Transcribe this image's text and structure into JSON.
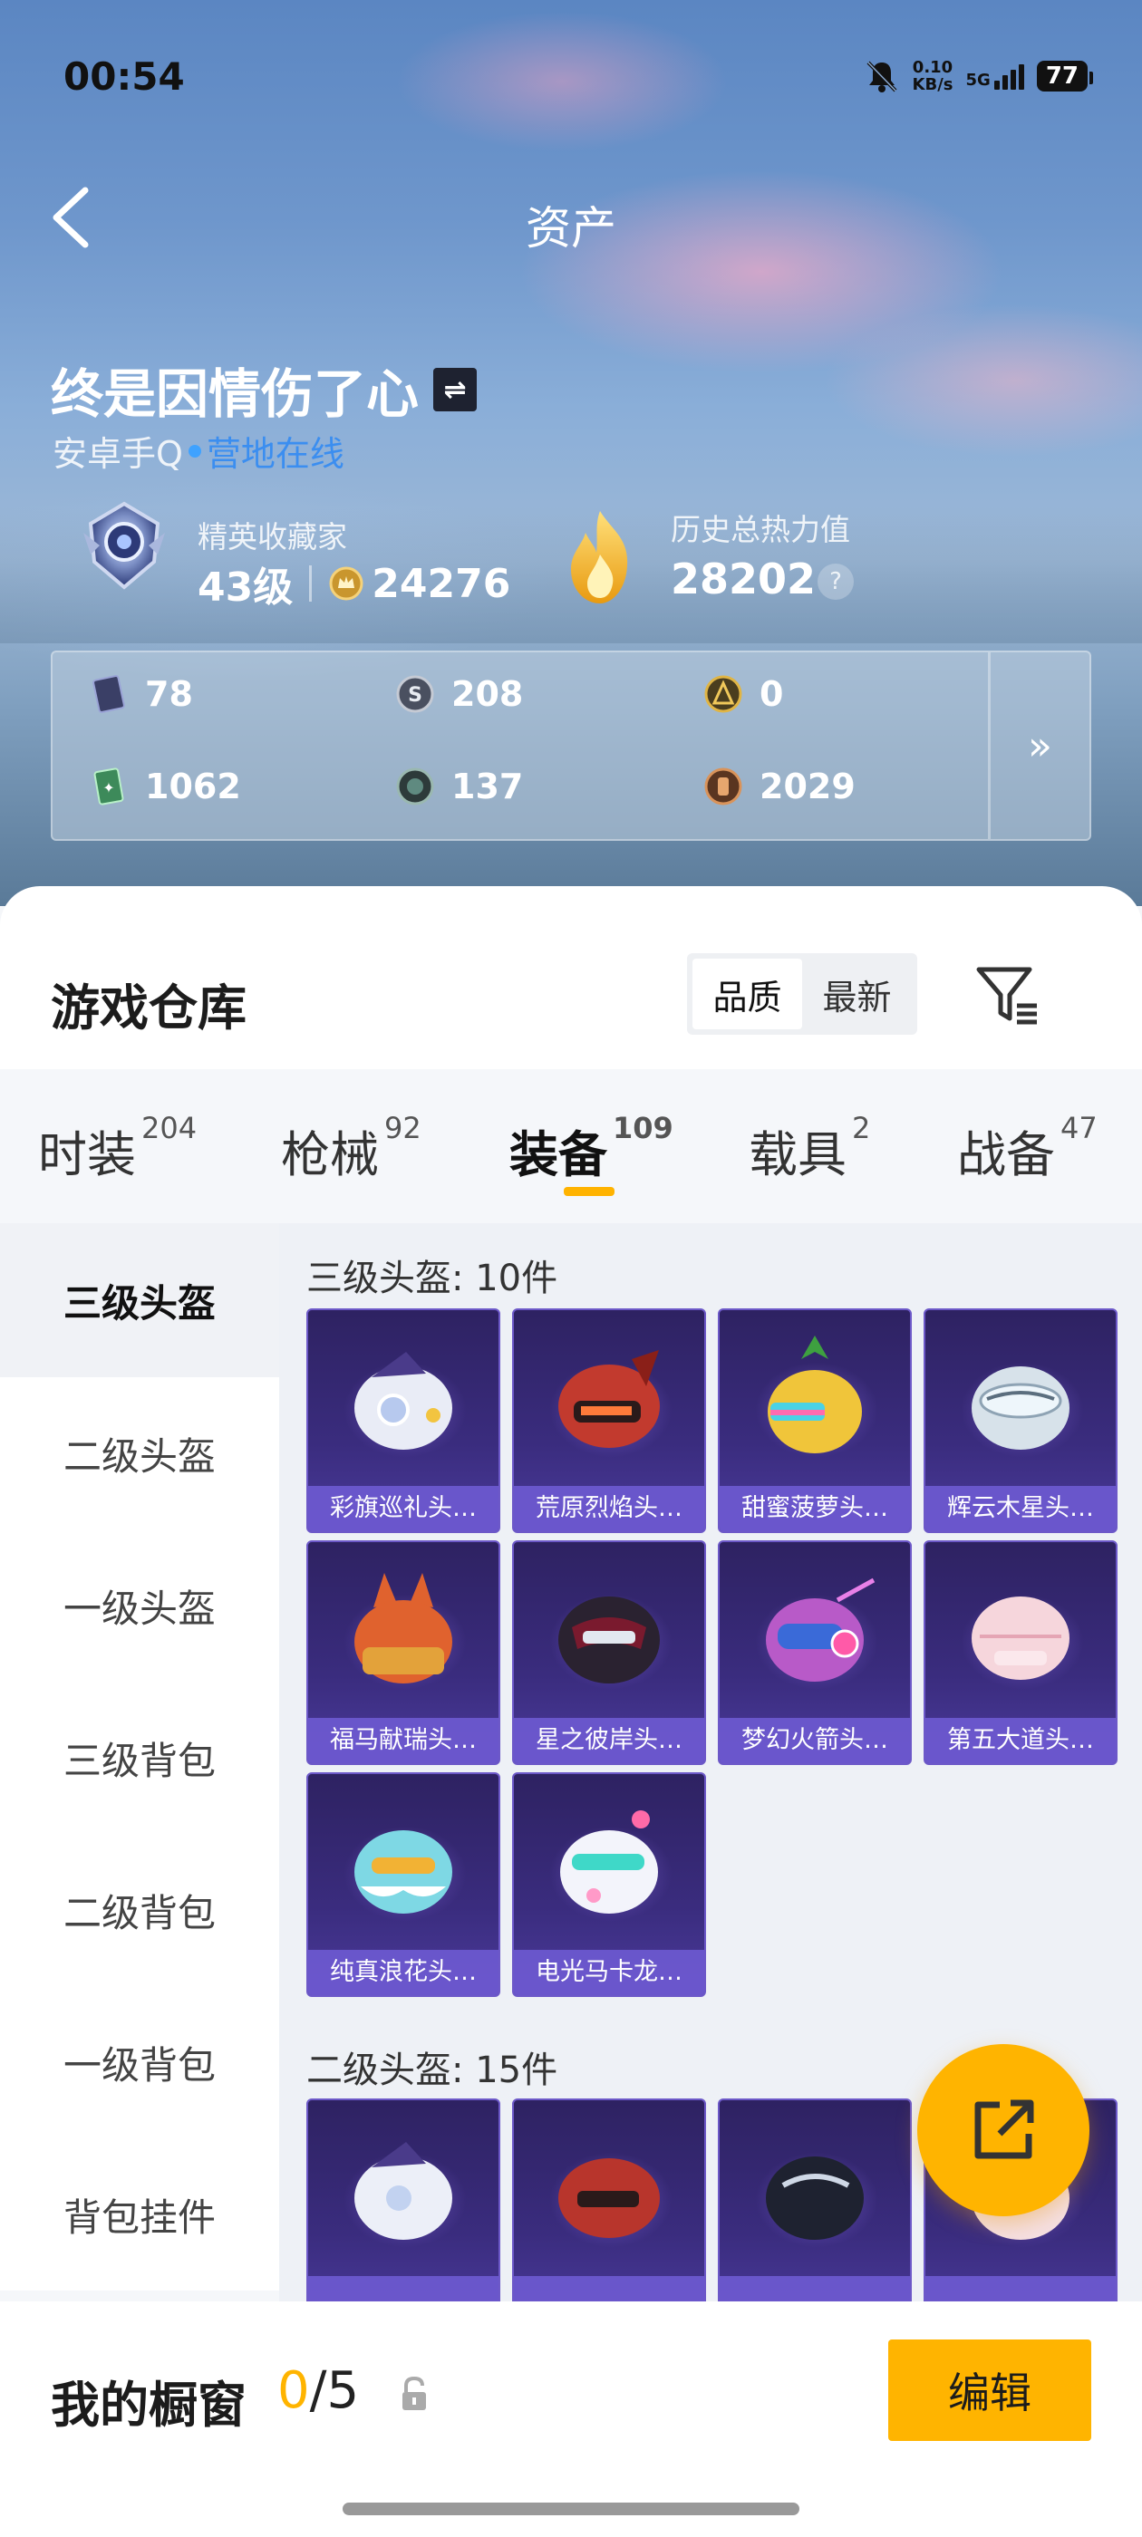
{
  "status_bar": {
    "time": "00:54",
    "net_speed_value": "0.10",
    "net_speed_unit": "KB/s",
    "network": "5G",
    "battery": "77"
  },
  "nav": {
    "title": "资产"
  },
  "profile": {
    "name": "终是因情伤了心",
    "platform": "安卓手Q",
    "online_status": "营地在线",
    "rank_title": "精英收藏家",
    "rank_level": "43级",
    "collection_points": "24276",
    "heat_title": "历史总热力值",
    "heat_value": "28202",
    "help": "?"
  },
  "currencies": [
    {
      "icon": "card-icon",
      "value": "78"
    },
    {
      "icon": "silver-coin-icon",
      "value": "208"
    },
    {
      "icon": "gold-coin-icon",
      "value": "0"
    },
    {
      "icon": "green-ticket-icon",
      "value": "1062"
    },
    {
      "icon": "dark-coin-icon",
      "value": "137"
    },
    {
      "icon": "bronze-coin-icon",
      "value": "2029"
    }
  ],
  "currency_more": "»",
  "warehouse": {
    "title": "游戏仓库",
    "sort_options": [
      "品质",
      "最新"
    ],
    "sort_selected": "品质"
  },
  "tabs": [
    {
      "label": "时装",
      "count": "204"
    },
    {
      "label": "枪械",
      "count": "92"
    },
    {
      "label": "装备",
      "count": "109",
      "active": true
    },
    {
      "label": "载具",
      "count": "2"
    },
    {
      "label": "战备",
      "count": "47"
    }
  ],
  "sidebar": [
    "三级头盔",
    "二级头盔",
    "一级头盔",
    "三级背包",
    "二级背包",
    "一级背包",
    "背包挂件"
  ],
  "sections": [
    {
      "title": "三级头盔: 10件",
      "items": [
        "彩旗巡礼头…",
        "荒原烈焰头…",
        "甜蜜菠萝头…",
        "辉云木星头…",
        "福马献瑞头…",
        "星之彼岸头…",
        "梦幻火箭头…",
        "第五大道头…",
        "纯真浪花头…",
        "电光马卡龙…"
      ]
    },
    {
      "title": "二级头盔: 15件",
      "items": [
        "",
        "",
        "",
        ""
      ]
    }
  ],
  "showcase": {
    "label": "我的橱窗",
    "current": "0",
    "separator": "/5",
    "edit_label": "编辑"
  },
  "colors": {
    "accent": "#ffb400",
    "online": "#3b8ef0",
    "tile_bg": "#3a2c7e",
    "tile_label": "#6e5ad2"
  }
}
